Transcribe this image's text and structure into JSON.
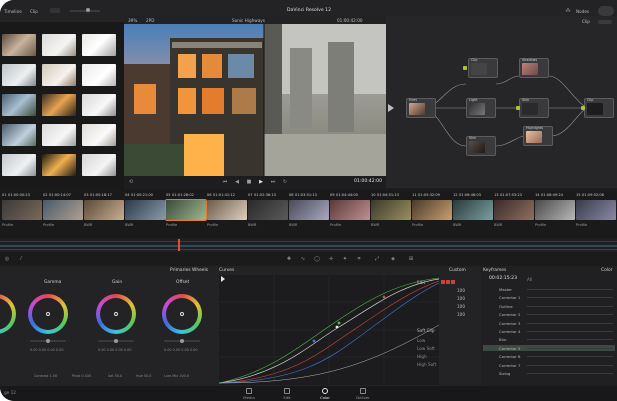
{
  "app": {
    "title": "DaVinci Resolve 12",
    "timeline_label": "Timeline",
    "clip_label": "Clip",
    "nodes_label": "Nodes",
    "nodes_panel_label": "Clip",
    "zoom": "39%"
  },
  "viewer": {
    "clip_name": "Sonic Highways",
    "timecode_top": "01:00:42:00",
    "timecode": "01:00:42:00",
    "marker": "2PD"
  },
  "nodes": {
    "items": [
      "Clip",
      "Shadows",
      "Eyes",
      "Light",
      "Skin",
      "Skin",
      "Highlights",
      "Clip"
    ]
  },
  "timeline": {
    "clip_numbers": [
      "01",
      "02",
      "03",
      "04",
      "05",
      "06",
      "07",
      "08",
      "09",
      "10",
      "11",
      "12",
      "13",
      "14",
      "15"
    ],
    "clip_timecodes": [
      "01:00:00:23",
      "01:00:14:07",
      "01:00:18:17",
      "01:00:21:00",
      "01:01:28:02",
      "01:01:41:12",
      "01:02:36:13",
      "01:03:51:13",
      "01:04:44:00",
      "01:04:51:13",
      "01:05:32:09",
      "01:06:46:03",
      "01:07:53:23",
      "01:08:49:24",
      "01:09:52:08"
    ],
    "clip_tags": [
      "Profile",
      "Profile",
      "BWR",
      "BWR",
      "Profile",
      "Profile",
      "BWR",
      "BWR",
      "Profile",
      "BWR",
      "Profile",
      "BWR",
      "BWR",
      "Profile",
      "Profile"
    ]
  },
  "wheels": {
    "panel_title": "Primaries Wheels",
    "names": [
      "Gamma",
      "Gain",
      "Offset"
    ],
    "values": [
      "0.00",
      "0.00",
      "0.00",
      "0.00"
    ],
    "footer": [
      "Contrast 1.00",
      "Pivot 0.435",
      "Sat 50.0",
      "Hue 50.0",
      "Lum Mix 100.0"
    ]
  },
  "curves": {
    "panel_title": "Curves"
  },
  "custom": {
    "panel_title": "Custom",
    "edit_label": "Edit",
    "values": [
      "100",
      "100",
      "100",
      "100"
    ],
    "soft_clip_label": "Soft Clip",
    "soft_rows": [
      "Low",
      "Low Soft",
      "High",
      "High Soft"
    ]
  },
  "keyframes": {
    "panel_title": "Keyframes",
    "timecode": "00:02:15:23",
    "filter": "All",
    "color_label": "Color",
    "rows": [
      "Master",
      "Corrector 1",
      "Outline",
      "Corrector 2",
      "Corrector 3",
      "Corrector 4",
      "Blur",
      "Corrector 5",
      "Corrector 6",
      "Corrector 7",
      "Sizing"
    ],
    "selected_index": 7
  },
  "pages": {
    "items": [
      "Media",
      "Edit",
      "Color",
      "Deliver"
    ],
    "active": "Color",
    "page_number": "ge 12"
  },
  "colors": {
    "accent_orange": "#e07a2c",
    "node_green": "#a7c63b",
    "selected_row": "#3c4a44"
  }
}
